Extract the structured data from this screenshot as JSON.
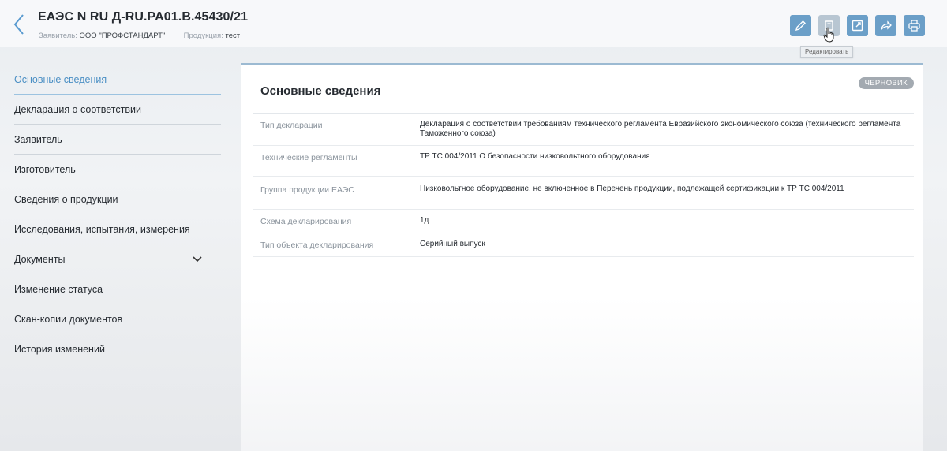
{
  "header": {
    "title": "ЕАЭС N RU Д-RU.PA01.B.45430/21",
    "applicant_label": "Заявитель:",
    "applicant_value": "ООО \"ПРОФСТАНДАРТ\"",
    "product_label": "Продукция:",
    "product_value": "тест",
    "tooltip": "Редактировать",
    "icons": [
      "back-chevron",
      "pencil-icon",
      "copy-icon",
      "external-link-icon",
      "share-arrow-icon",
      "print-icon"
    ]
  },
  "sidebar": {
    "items": [
      {
        "label": "Основные сведения",
        "active": true
      },
      {
        "label": "Декларация о соответствии"
      },
      {
        "label": "Заявитель"
      },
      {
        "label": "Изготовитель"
      },
      {
        "label": "Сведения о продукции"
      },
      {
        "label": "Исследования, испытания, измерения"
      },
      {
        "label": "Документы",
        "has_chevron": true
      },
      {
        "label": "Изменение статуса"
      },
      {
        "label": "Скан-копии документов"
      },
      {
        "label": "История изменений"
      }
    ]
  },
  "main": {
    "title": "Основные сведения",
    "badge": "ЧЕРНОВИК",
    "rows": [
      {
        "key": "Тип декларации",
        "value": "Декларация о соответствии требованиям технического регламента Евразийского экономического союза (технического регламента Таможенного союза)"
      },
      {
        "key": "Технические регламенты",
        "value": "ТР ТС 004/2011 О безопасности низковольтного оборудования"
      },
      {
        "key": "Группа продукции ЕАЭС",
        "value": "Низковольтное оборудование, не включенное в Перечень продукции, подлежащей сертификации к ТР ТС 004/2011"
      },
      {
        "key": "Схема декларирования",
        "value": "1д"
      },
      {
        "key": "Тип объекта декларирования",
        "value": "Серийный выпуск"
      }
    ]
  },
  "colors": {
    "accent": "#4a8fc4",
    "tool_button": "#6b9fc8",
    "badge": "#a3aab1"
  }
}
